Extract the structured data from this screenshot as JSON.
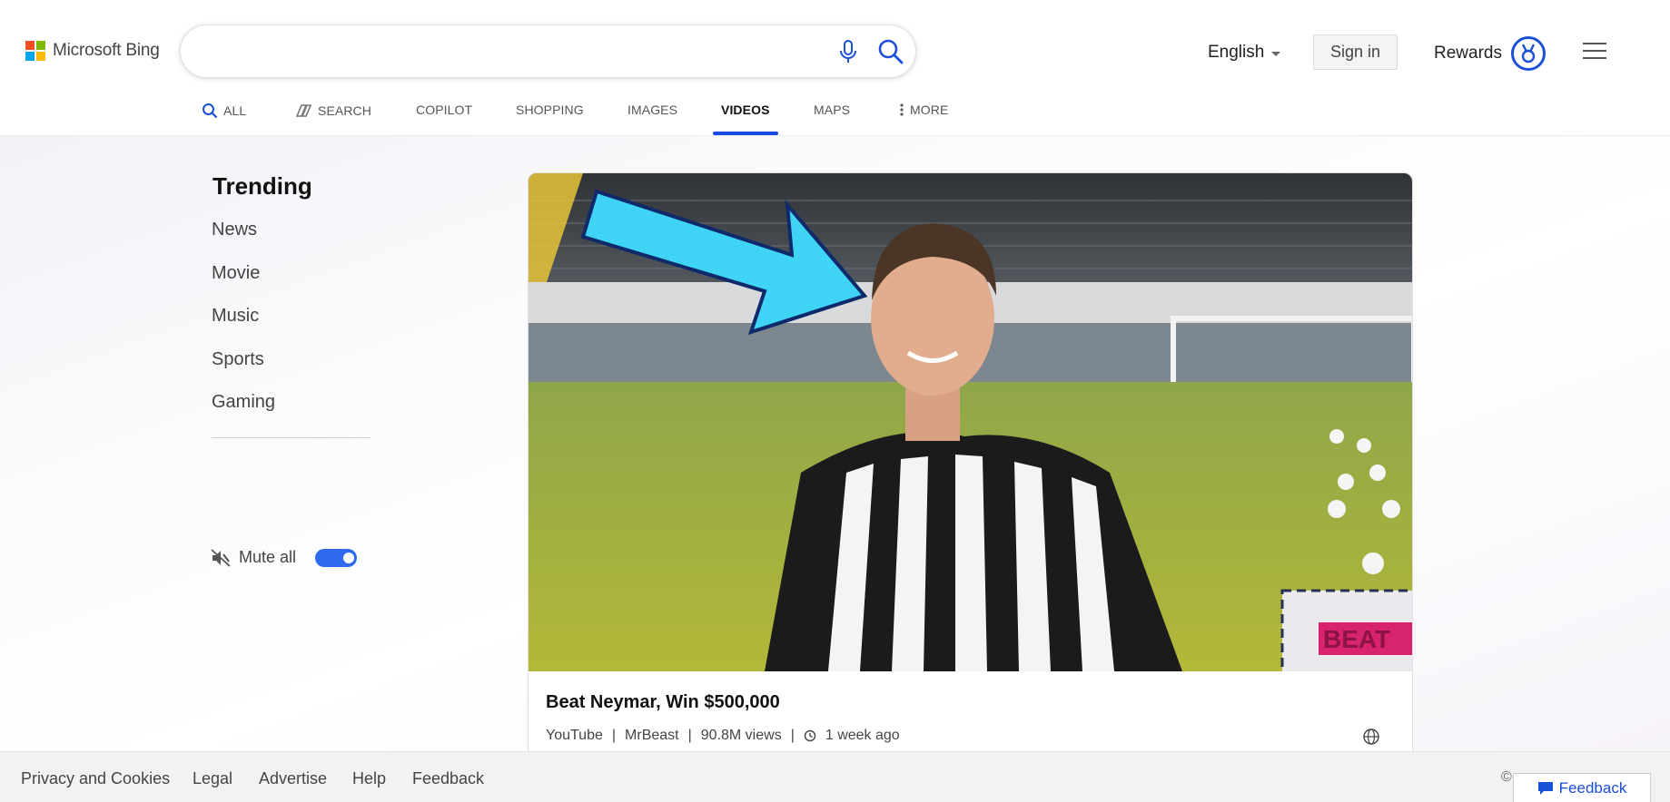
{
  "brand": {
    "name": "Microsoft Bing",
    "logo_colors": [
      "#f25022",
      "#7fba00",
      "#00a4ef",
      "#ffb900"
    ]
  },
  "search": {
    "value": "",
    "placeholder": "",
    "mic_icon": "microphone-icon",
    "search_icon": "search-icon"
  },
  "header": {
    "language": "English",
    "sign_in": "Sign in",
    "rewards": "Rewards",
    "menu_icon": "hamburger-menu-icon"
  },
  "tabs": [
    {
      "label": "ALL",
      "icon": "search-icon"
    },
    {
      "label": "SEARCH",
      "icon": "copilot-search-icon"
    },
    {
      "label": "COPILOT"
    },
    {
      "label": "SHOPPING"
    },
    {
      "label": "IMAGES"
    },
    {
      "label": "VIDEOS",
      "active": true
    },
    {
      "label": "MAPS"
    },
    {
      "label": "MORE",
      "icon": "more-vertical-icon"
    }
  ],
  "trending": {
    "title": "Trending",
    "items": [
      "News",
      "Movie",
      "Music",
      "Sports",
      "Gaming"
    ]
  },
  "mute": {
    "label": "Mute all",
    "enabled": true
  },
  "video": {
    "title": "Beat Neymar, Win $500,000",
    "source": "YouTube",
    "channel": "MrBeast",
    "views": "90.8M views",
    "age": "1 week ago",
    "thumbnail_text": "BEAT"
  },
  "footer": {
    "links": [
      "Privacy and Cookies",
      "Legal",
      "Advertise",
      "Help",
      "Feedback"
    ],
    "copyright": "©",
    "feedback_button": "Feedback"
  },
  "colors": {
    "accent": "#174ae4",
    "toggle": "#2d6bec"
  }
}
